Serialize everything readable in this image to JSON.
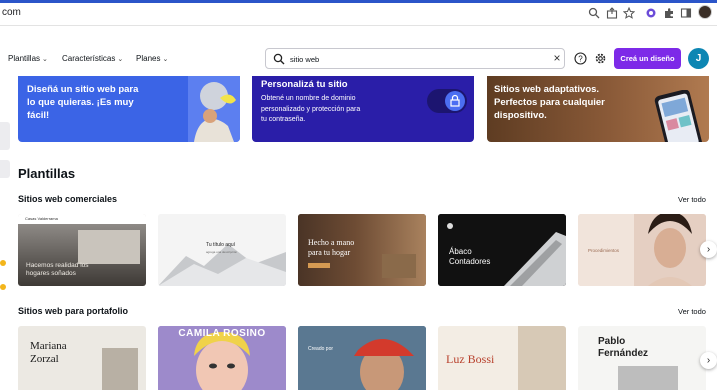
{
  "browser": {
    "url_fragment": "com",
    "toolbar_icons": [
      "zoom-icon",
      "share-icon",
      "bookmark-star-icon",
      "extension-icon",
      "puzzle-icon",
      "sidebar-icon",
      "profile-avatar"
    ]
  },
  "header": {
    "nav": [
      {
        "label": "Plantillas"
      },
      {
        "label": "Características"
      },
      {
        "label": "Planes"
      }
    ],
    "search": {
      "value": "sitio web",
      "placeholder": ""
    },
    "create_label": "Creá un diseño",
    "avatar_initial": "J",
    "colors": {
      "accent": "#7d2ae8",
      "avatar": "#0d86b3"
    }
  },
  "banners": [
    {
      "title_lines": [
        "Diseñá un sitio web para",
        "lo que quieras. ¡Es muy",
        "fácil!"
      ]
    },
    {
      "title": "Personalizá tu sitio",
      "subtitle_lines": [
        "Obtené un nombre de dominio",
        "personalizado y protección para",
        "tu contraseña."
      ]
    },
    {
      "title_lines": [
        "Sitios web adaptativos.",
        "Perfectos para cualquier",
        "dispositivo."
      ]
    }
  ],
  "section_title": "Plantillas",
  "rows": [
    {
      "title": "Sitios web comerciales",
      "see_all": "Ver todo",
      "templates": [
        {
          "name": "Casas Valderrama",
          "caption_lines": [
            "Hacemos realidad los",
            "hogares soñados"
          ]
        },
        {
          "name": "Tu título aquí",
          "caption_lines": [
            "Tu título aquí",
            "agrega una descripción"
          ]
        },
        {
          "name": "Hecho a mano para tu hogar",
          "caption_lines": [
            "Hecho a mano",
            "para tu hogar"
          ]
        },
        {
          "name": "Ábaco Contadores",
          "caption_lines": [
            "Ábaco",
            "Contadores"
          ]
        },
        {
          "name": "Procedimientos",
          "caption_lines": [
            "Procedimientos"
          ]
        }
      ]
    },
    {
      "title": "Sitios web para portafolio",
      "see_all": "Ver todo",
      "templates": [
        {
          "name": "Mariana Zorzal",
          "caption_lines": [
            "Mariana",
            "Zorzal"
          ]
        },
        {
          "name": "Camila Rosino",
          "caption_lines": [
            "CAMILA ROSINO"
          ]
        },
        {
          "name": "Creado por",
          "caption_lines": [
            "Creado por"
          ]
        },
        {
          "name": "Luz Bossi",
          "caption_lines": [
            "Luz Bossi"
          ]
        },
        {
          "name": "Pablo Fernández",
          "caption_lines": [
            "Pablo",
            "Fernández"
          ]
        }
      ]
    }
  ]
}
